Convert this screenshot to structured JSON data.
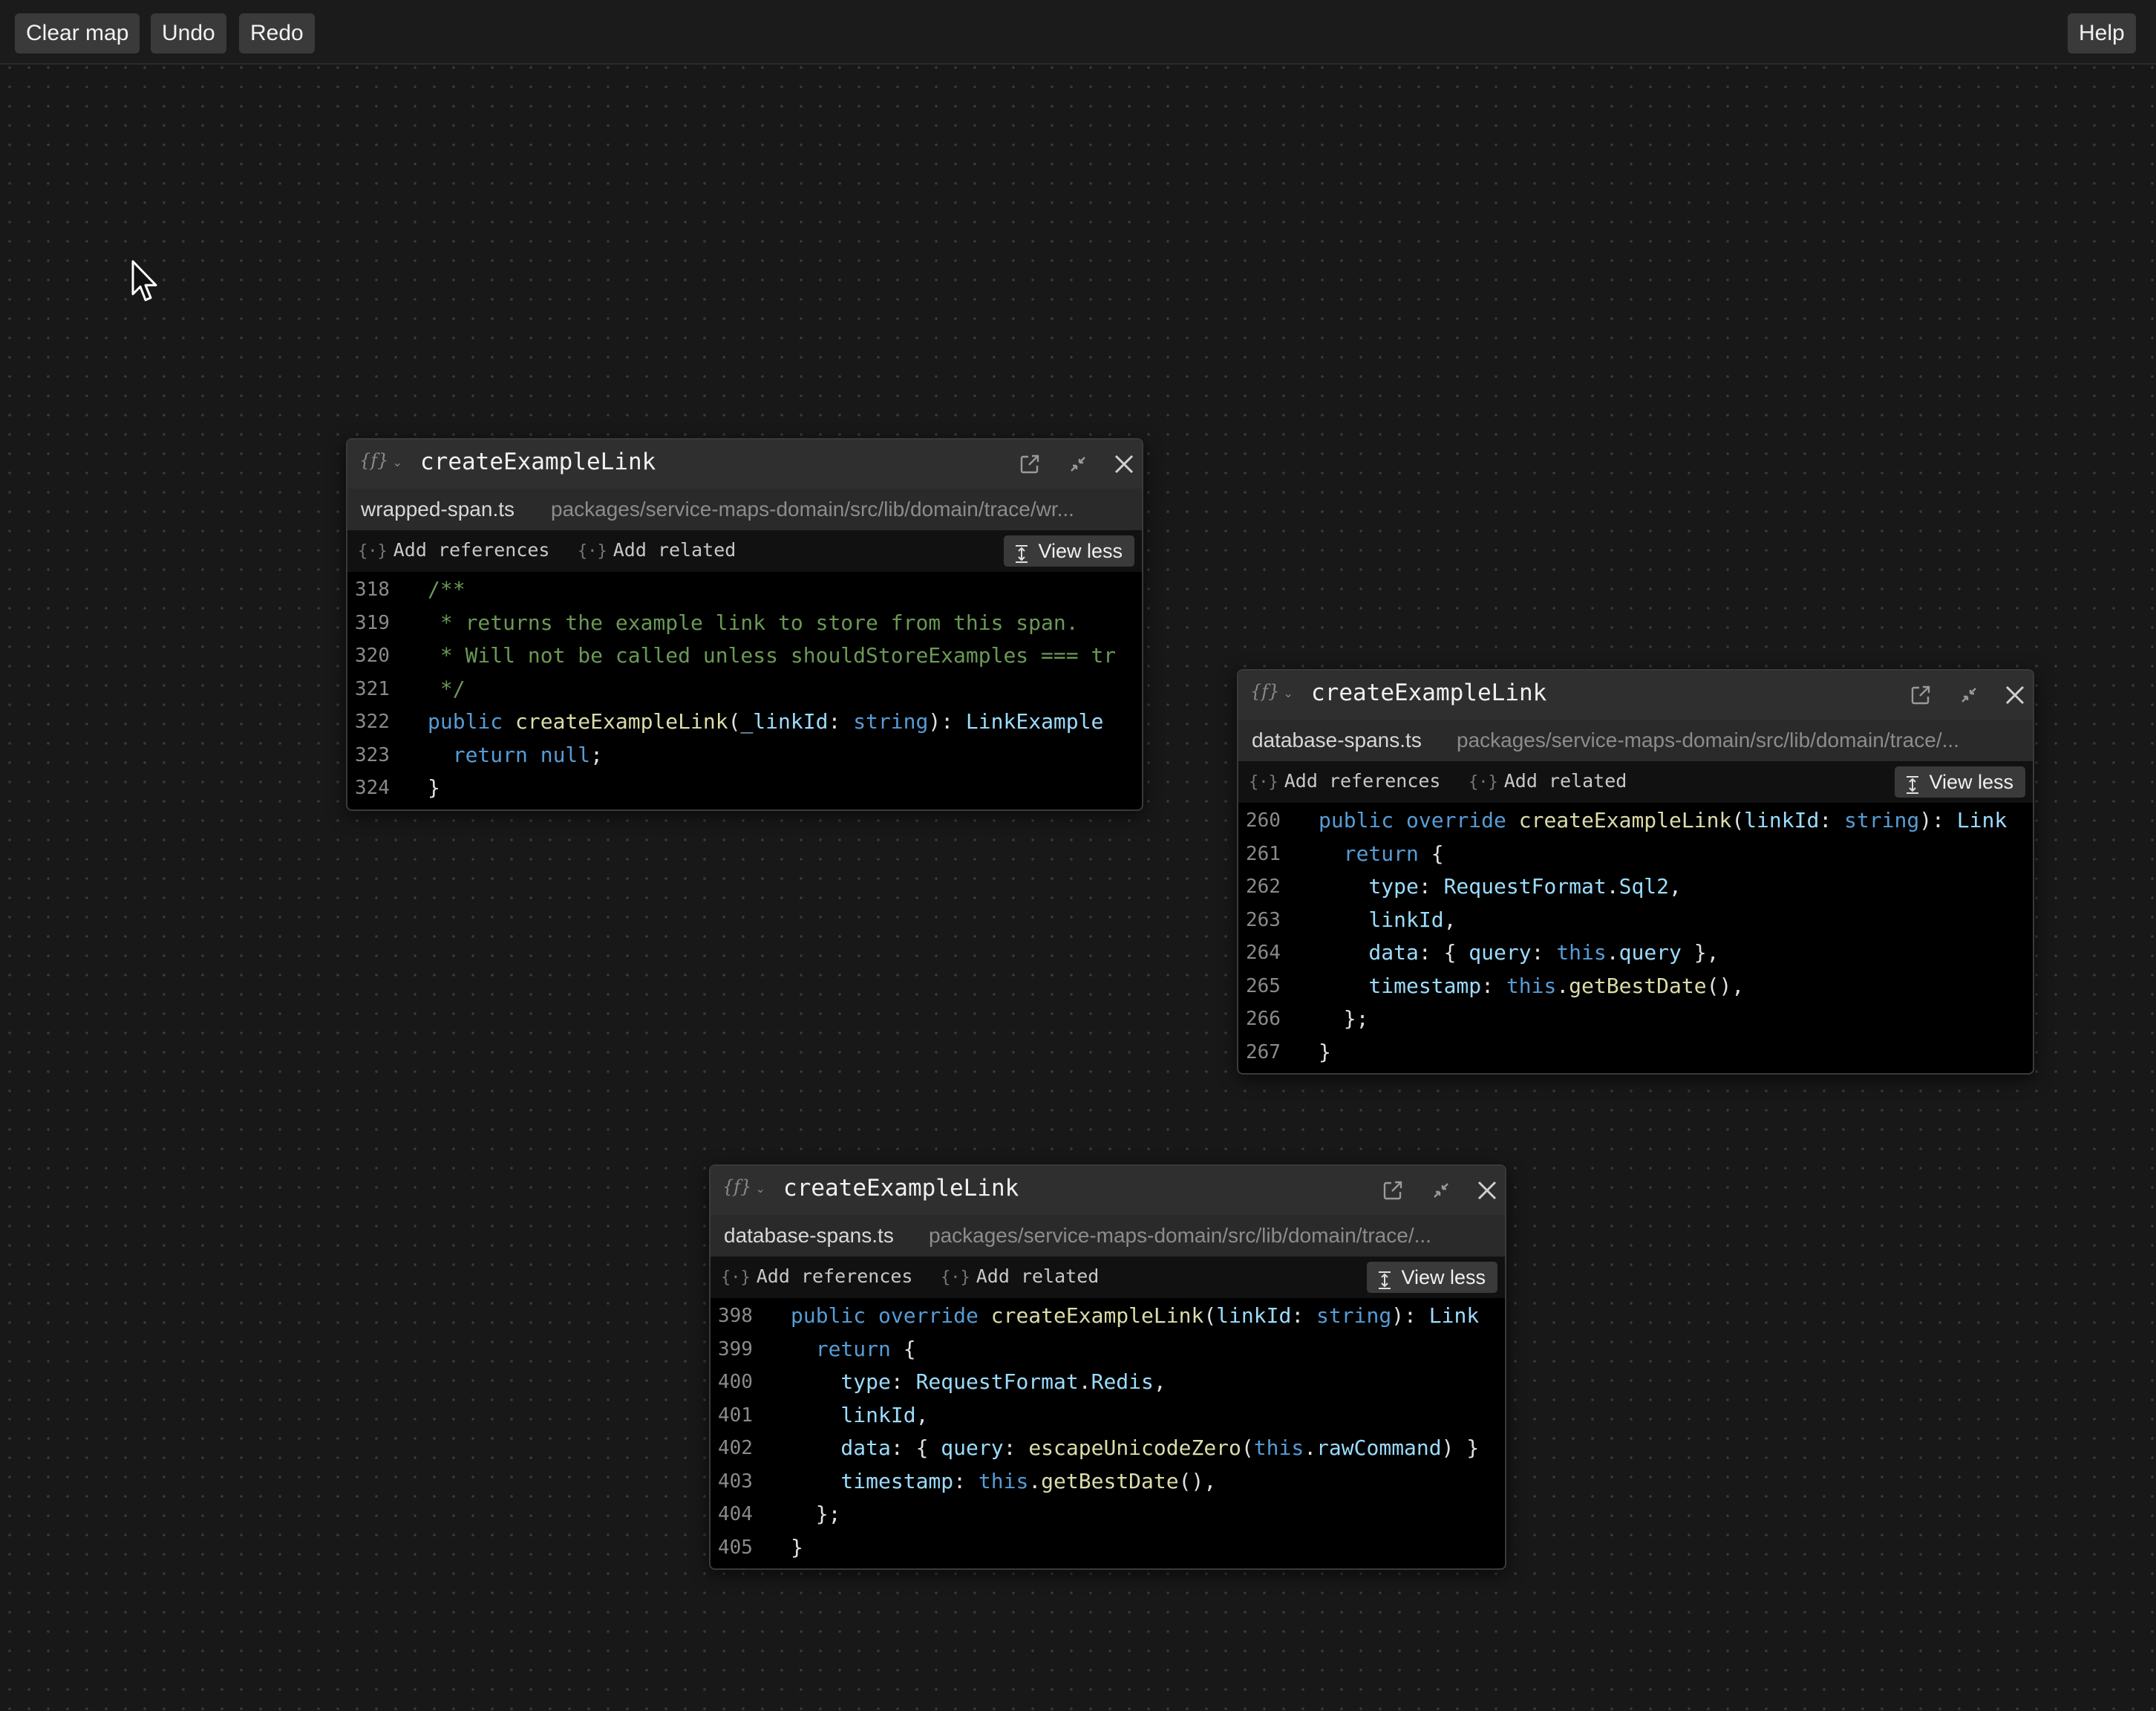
{
  "toolbar": {
    "clear_map": "Clear map",
    "undo": "Undo",
    "redo": "Redo",
    "help": "Help"
  },
  "icons": {
    "function": "function-icon",
    "open_external": "external-link-icon",
    "collapse": "collapse-icon",
    "close": "close-icon",
    "view_less": "view-less-icon"
  },
  "colors": {
    "background": "#181818",
    "comment": "#6a9955",
    "keyword": "#569cd6",
    "function": "#dcdcaa",
    "variable": "#9cdcfe",
    "type": "#4ec9b0"
  },
  "cards": [
    {
      "fn_icon": "{f}",
      "title": "createExampleLink",
      "file_name": "wrapped-span.ts",
      "file_path": "packages/service-maps-domain/src/lib/domain/trace/wr...",
      "add_references": "Add references",
      "add_related": "Add related",
      "view_less": "View less",
      "lines": [
        {
          "num": "318",
          "tokens": [
            {
              "t": "/**",
              "c": "comment"
            }
          ]
        },
        {
          "num": "319",
          "tokens": [
            {
              "t": " * returns the example link to store from this span.",
              "c": "comment"
            }
          ]
        },
        {
          "num": "320",
          "tokens": [
            {
              "t": " * Will not be called unless shouldStoreExamples === tr",
              "c": "comment"
            }
          ]
        },
        {
          "num": "321",
          "tokens": [
            {
              "t": " */",
              "c": "comment"
            }
          ]
        },
        {
          "num": "322",
          "tokens": [
            {
              "t": "public ",
              "c": "kw"
            },
            {
              "t": "createExampleLink",
              "c": "fn"
            },
            {
              "t": "(",
              "c": "punc"
            },
            {
              "t": "_linkId",
              "c": "var"
            },
            {
              "t": ": ",
              "c": "punc"
            },
            {
              "t": "string",
              "c": "kw"
            },
            {
              "t": "): ",
              "c": "punc"
            },
            {
              "t": "LinkExample",
              "c": "var"
            }
          ]
        },
        {
          "num": "323",
          "tokens": [
            {
              "t": "  return ",
              "c": "kw"
            },
            {
              "t": "null",
              "c": "kw"
            },
            {
              "t": ";",
              "c": "punc"
            }
          ]
        },
        {
          "num": "324",
          "tokens": [
            {
              "t": "}",
              "c": "punc"
            }
          ]
        }
      ]
    },
    {
      "fn_icon": "{f}",
      "title": "createExampleLink",
      "file_name": "database-spans.ts",
      "file_path": "packages/service-maps-domain/src/lib/domain/trace/...",
      "add_references": "Add references",
      "add_related": "Add related",
      "view_less": "View less",
      "lines": [
        {
          "num": "260",
          "tokens": [
            {
              "t": "public ",
              "c": "kw"
            },
            {
              "t": "override ",
              "c": "kw"
            },
            {
              "t": "createExampleLink",
              "c": "fn"
            },
            {
              "t": "(",
              "c": "punc"
            },
            {
              "t": "linkId",
              "c": "var"
            },
            {
              "t": ": ",
              "c": "punc"
            },
            {
              "t": "string",
              "c": "kw"
            },
            {
              "t": "): ",
              "c": "punc"
            },
            {
              "t": "Link",
              "c": "var"
            }
          ]
        },
        {
          "num": "261",
          "tokens": [
            {
              "t": "  return ",
              "c": "kw"
            },
            {
              "t": "{",
              "c": "punc"
            }
          ]
        },
        {
          "num": "262",
          "tokens": [
            {
              "t": "    type",
              "c": "var"
            },
            {
              "t": ": ",
              "c": "punc"
            },
            {
              "t": "RequestFormat",
              "c": "var"
            },
            {
              "t": ".",
              "c": "punc"
            },
            {
              "t": "Sql2",
              "c": "var"
            },
            {
              "t": ",",
              "c": "punc"
            }
          ]
        },
        {
          "num": "263",
          "tokens": [
            {
              "t": "    linkId",
              "c": "var"
            },
            {
              "t": ",",
              "c": "punc"
            }
          ]
        },
        {
          "num": "264",
          "tokens": [
            {
              "t": "    data",
              "c": "var"
            },
            {
              "t": ": { ",
              "c": "punc"
            },
            {
              "t": "query",
              "c": "var"
            },
            {
              "t": ": ",
              "c": "punc"
            },
            {
              "t": "this",
              "c": "kw"
            },
            {
              "t": ".",
              "c": "punc"
            },
            {
              "t": "query",
              "c": "var"
            },
            {
              "t": " },",
              "c": "punc"
            }
          ]
        },
        {
          "num": "265",
          "tokens": [
            {
              "t": "    timestamp",
              "c": "var"
            },
            {
              "t": ": ",
              "c": "punc"
            },
            {
              "t": "this",
              "c": "kw"
            },
            {
              "t": ".",
              "c": "punc"
            },
            {
              "t": "getBestDate",
              "c": "fn"
            },
            {
              "t": "(),",
              "c": "punc"
            }
          ]
        },
        {
          "num": "266",
          "tokens": [
            {
              "t": "  };",
              "c": "punc"
            }
          ]
        },
        {
          "num": "267",
          "tokens": [
            {
              "t": "}",
              "c": "punc"
            }
          ]
        }
      ]
    },
    {
      "fn_icon": "{f}",
      "title": "createExampleLink",
      "file_name": "database-spans.ts",
      "file_path": "packages/service-maps-domain/src/lib/domain/trace/...",
      "add_references": "Add references",
      "add_related": "Add related",
      "view_less": "View less",
      "lines": [
        {
          "num": "398",
          "tokens": [
            {
              "t": "public ",
              "c": "kw"
            },
            {
              "t": "override ",
              "c": "kw"
            },
            {
              "t": "createExampleLink",
              "c": "fn"
            },
            {
              "t": "(",
              "c": "punc"
            },
            {
              "t": "linkId",
              "c": "var"
            },
            {
              "t": ": ",
              "c": "punc"
            },
            {
              "t": "string",
              "c": "kw"
            },
            {
              "t": "): ",
              "c": "punc"
            },
            {
              "t": "Link",
              "c": "var"
            }
          ]
        },
        {
          "num": "399",
          "tokens": [
            {
              "t": "  return ",
              "c": "kw"
            },
            {
              "t": "{",
              "c": "punc"
            }
          ]
        },
        {
          "num": "400",
          "tokens": [
            {
              "t": "    type",
              "c": "var"
            },
            {
              "t": ": ",
              "c": "punc"
            },
            {
              "t": "RequestFormat",
              "c": "var"
            },
            {
              "t": ".",
              "c": "punc"
            },
            {
              "t": "Redis",
              "c": "var"
            },
            {
              "t": ",",
              "c": "punc"
            }
          ]
        },
        {
          "num": "401",
          "tokens": [
            {
              "t": "    linkId",
              "c": "var"
            },
            {
              "t": ",",
              "c": "punc"
            }
          ]
        },
        {
          "num": "402",
          "tokens": [
            {
              "t": "    data",
              "c": "var"
            },
            {
              "t": ": { ",
              "c": "punc"
            },
            {
              "t": "query",
              "c": "var"
            },
            {
              "t": ": ",
              "c": "punc"
            },
            {
              "t": "escapeUnicodeZero",
              "c": "fn"
            },
            {
              "t": "(",
              "c": "punc"
            },
            {
              "t": "this",
              "c": "kw"
            },
            {
              "t": ".",
              "c": "punc"
            },
            {
              "t": "rawCommand",
              "c": "var"
            },
            {
              "t": ") }",
              "c": "punc"
            }
          ]
        },
        {
          "num": "403",
          "tokens": [
            {
              "t": "    timestamp",
              "c": "var"
            },
            {
              "t": ": ",
              "c": "punc"
            },
            {
              "t": "this",
              "c": "kw"
            },
            {
              "t": ".",
              "c": "punc"
            },
            {
              "t": "getBestDate",
              "c": "fn"
            },
            {
              "t": "(),",
              "c": "punc"
            }
          ]
        },
        {
          "num": "404",
          "tokens": [
            {
              "t": "  };",
              "c": "punc"
            }
          ]
        },
        {
          "num": "405",
          "tokens": [
            {
              "t": "}",
              "c": "punc"
            }
          ]
        }
      ]
    }
  ]
}
